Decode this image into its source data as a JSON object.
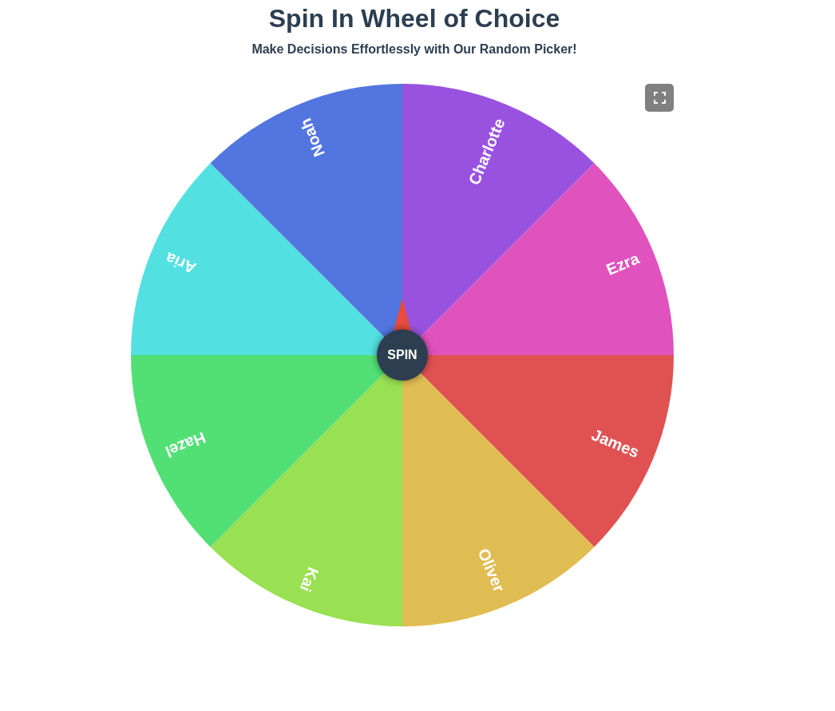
{
  "header": {
    "title": "Spin In Wheel of Choice",
    "subtitle": "Make Decisions Effortlessly with Our Random Picker!"
  },
  "wheel": {
    "segments": [
      {
        "label": "Charlotte",
        "color": "#9952e0"
      },
      {
        "label": "Ezra",
        "color": "#e052bd"
      },
      {
        "label": "James",
        "color": "#e05252"
      },
      {
        "label": "Oliver",
        "color": "#e0bd52"
      },
      {
        "label": "Kai",
        "color": "#99e052"
      },
      {
        "label": "Hazel",
        "color": "#52e075"
      },
      {
        "label": "Aria",
        "color": "#52e0e0"
      },
      {
        "label": "Noah",
        "color": "#5275e0"
      }
    ],
    "spin_button": {
      "label": "SPIN"
    }
  }
}
